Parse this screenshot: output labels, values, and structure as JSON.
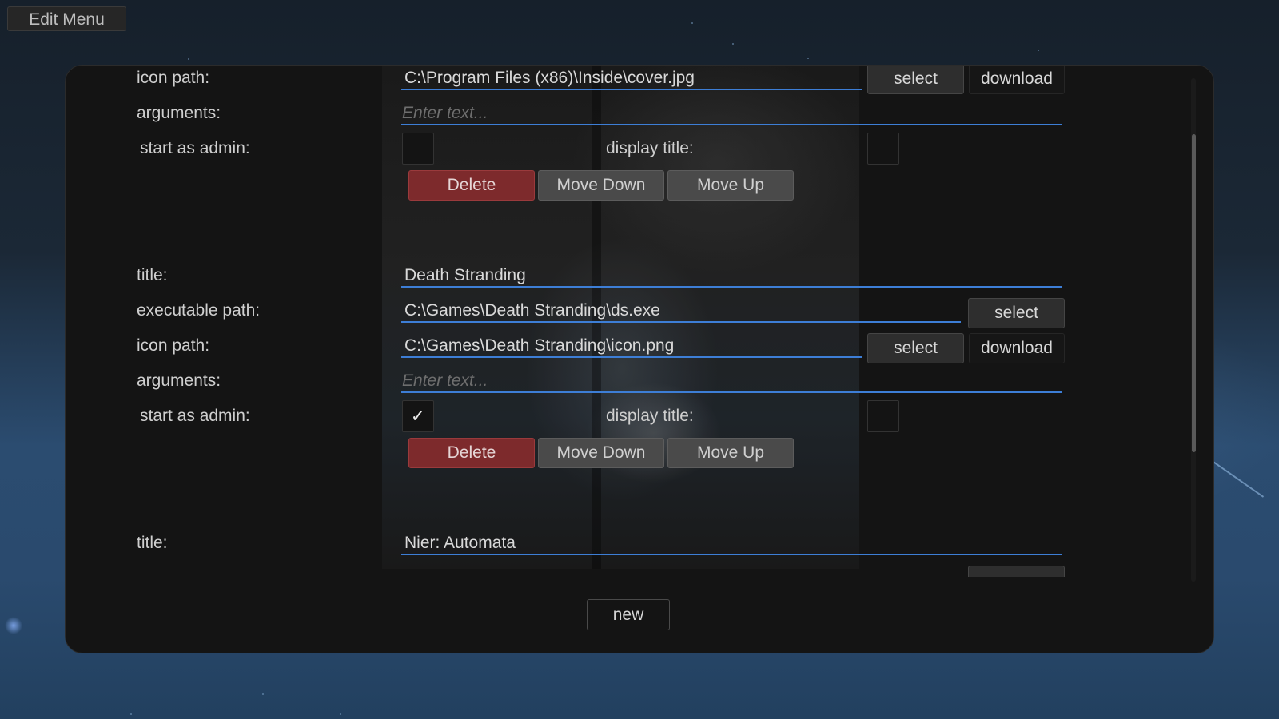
{
  "header": {
    "edit_menu_label": "Edit Menu"
  },
  "labels": {
    "title": "title:",
    "executable_path": "executable path:",
    "icon_path": "icon path:",
    "arguments": "arguments:",
    "start_as_admin": "start as admin:",
    "display_title": "display title:"
  },
  "buttons": {
    "select": "select",
    "download": "download",
    "delete": "Delete",
    "move_down": "Move Down",
    "move_up": "Move Up",
    "new": "new"
  },
  "placeholders": {
    "arguments": "Enter text..."
  },
  "checkmark": "✓",
  "entries": [
    {
      "icon_path": "C:\\Program Files (x86)\\Inside\\cover.jpg",
      "arguments": "",
      "start_as_admin": false,
      "display_title": false
    },
    {
      "title": "Death Stranding",
      "executable_path": "C:\\Games\\Death Stranding\\ds.exe",
      "icon_path": "C:\\Games\\Death Stranding\\icon.png",
      "arguments": "",
      "start_as_admin": true,
      "display_title": false
    },
    {
      "title": "Nier: Automata"
    }
  ]
}
